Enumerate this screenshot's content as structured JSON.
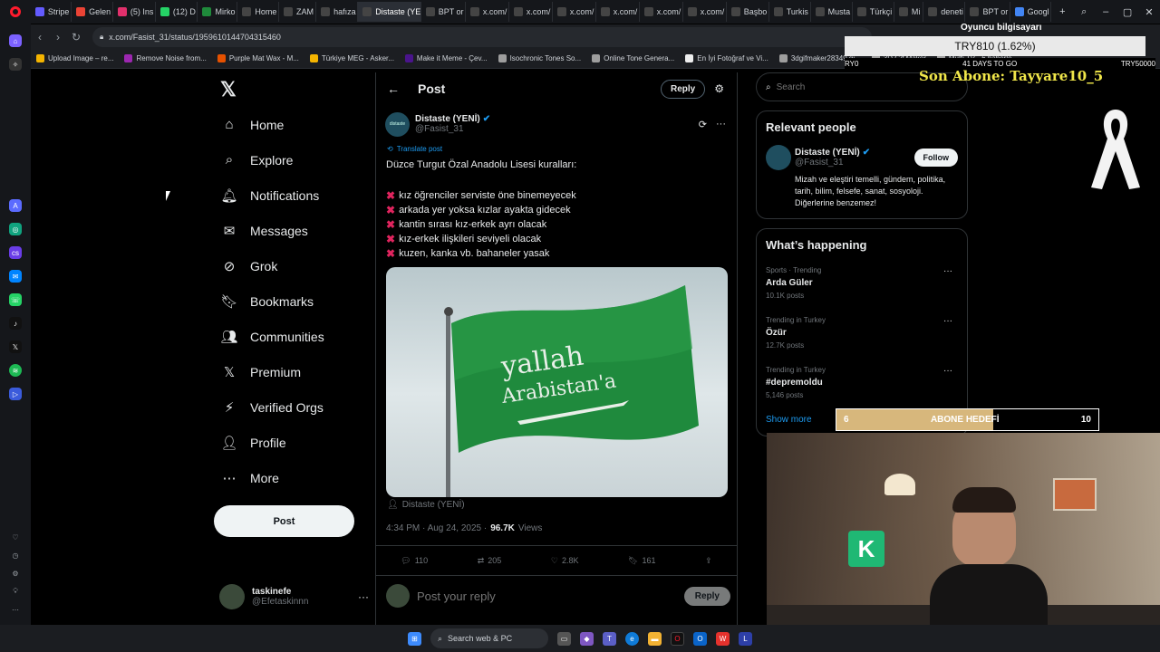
{
  "browser": {
    "tabs": [
      {
        "label": "Stripe",
        "color": "#635bff"
      },
      {
        "label": "Gelen",
        "color": "#ea4335"
      },
      {
        "label": "(5) Ins",
        "color": "#e1306c"
      },
      {
        "label": "(12) D",
        "color": "#25d366"
      },
      {
        "label": "Mirko",
        "color": "#1f8a3b"
      },
      {
        "label": "Home",
        "color": "#444"
      },
      {
        "label": "ZAM",
        "color": "#444"
      },
      {
        "label": "hafıza",
        "color": "#444"
      },
      {
        "label": "Distaste (YE",
        "color": "#444",
        "active": true
      },
      {
        "label": "BPT or",
        "color": "#444"
      },
      {
        "label": "x.com/",
        "color": "#444"
      },
      {
        "label": "x.com/",
        "color": "#444"
      },
      {
        "label": "x.com/",
        "color": "#444"
      },
      {
        "label": "x.com/",
        "color": "#444"
      },
      {
        "label": "x.com/",
        "color": "#444"
      },
      {
        "label": "x.com/",
        "color": "#444"
      },
      {
        "label": "Başbo",
        "color": "#444"
      },
      {
        "label": "Turkis",
        "color": "#444"
      },
      {
        "label": "Musta",
        "color": "#444"
      },
      {
        "label": "Türkçi",
        "color": "#444"
      },
      {
        "label": "Mi",
        "color": "#444"
      },
      {
        "label": "deneti",
        "color": "#444"
      },
      {
        "label": "BPT or",
        "color": "#444"
      },
      {
        "label": "Googl",
        "color": "#4285f4"
      }
    ],
    "url": "x.com/Fasist_31/status/1959610144704315460",
    "bookmarks": [
      {
        "label": "Upload Image – re...",
        "color": "#f4b400"
      },
      {
        "label": "Remove Noise from...",
        "color": "#9c27b0"
      },
      {
        "label": "Purple Mat Wax - M...",
        "color": "#e65100"
      },
      {
        "label": "Türkiye MEG - Asker...",
        "color": "#f4b400"
      },
      {
        "label": "Make it Meme - Çev...",
        "color": "#4a148c"
      },
      {
        "label": "Isochronic Tones So...",
        "color": "#9e9e9e"
      },
      {
        "label": "Online Tone Genera...",
        "color": "#9e9e9e"
      },
      {
        "label": "En İyi Fotoğraf ve Vi...",
        "color": "#eeeeee"
      },
      {
        "label": "3dgifmaker28349.gi...",
        "color": "#9e9e9e"
      },
      {
        "label": "3D Gif Maker",
        "color": "#9e9e9e"
      },
      {
        "label": "Multi TV - 6 haberle",
        "color": "#9e9e9e"
      }
    ]
  },
  "nav": {
    "items": [
      {
        "label": "Home",
        "icon": "home-icon"
      },
      {
        "label": "Explore",
        "icon": "search-icon"
      },
      {
        "label": "Notifications",
        "icon": "bell-icon"
      },
      {
        "label": "Messages",
        "icon": "mail-icon"
      },
      {
        "label": "Grok",
        "icon": "grok-icon"
      },
      {
        "label": "Bookmarks",
        "icon": "bookmark-icon"
      },
      {
        "label": "Communities",
        "icon": "people-icon"
      },
      {
        "label": "Premium",
        "icon": "x-icon"
      },
      {
        "label": "Verified Orgs",
        "icon": "bolt-icon"
      },
      {
        "label": "Profile",
        "icon": "user-icon"
      },
      {
        "label": "More",
        "icon": "more-icon"
      }
    ],
    "post_button": "Post",
    "account": {
      "name": "taskinefe",
      "handle": "@Efetaskinnn"
    }
  },
  "post": {
    "header_title": "Post",
    "reply_button": "Reply",
    "author_name": "Distaste (YENİ)",
    "author_handle": "@Fasist_31",
    "avatar_text": "distaste",
    "translate": "Translate post",
    "intro": "Düzce Turgut Özal Anadolu Lisesi kuralları:",
    "rules": [
      "kız öğrenciler serviste öne binemeyecek",
      "arkada yer yoksa kızlar ayakta gidecek",
      "kantin sırası kız-erkek ayrı olacak",
      "kız-erkek ilişkileri seviyeli olacak",
      "kuzen, kanka vb. bahaneler yasak"
    ],
    "flag_text_1": "yallah",
    "flag_text_2": "Arabistan'a",
    "image_credit": "Distaste (YENİ)",
    "timestamp": "4:34 PM · Aug 24, 2025 ·",
    "views_count": "96.7K",
    "views_label": "Views",
    "stats": {
      "replies": "110",
      "reposts": "205",
      "likes": "2.8K",
      "bookmarks": "161"
    },
    "reply_placeholder": "Post your reply",
    "reply_submit": "Reply"
  },
  "right": {
    "search_placeholder": "Search",
    "relevant_title": "Relevant people",
    "person": {
      "name": "Distaste (YENİ)",
      "handle": "@Fasist_31",
      "follow": "Follow",
      "bio": "Mizah ve eleştiri temelli, gündem, politika, tarih, bilim, felsefe, sanat, sosyoloji. Diğerlerine benzemez!"
    },
    "happening_title": "What’s happening",
    "trends": [
      {
        "context": "Sports · Trending",
        "name": "Arda Güler",
        "posts": "10.1K posts"
      },
      {
        "context": "Trending in Turkey",
        "name": "Özür",
        "posts": "12.7K posts"
      },
      {
        "context": "Trending in Turkey",
        "name": "#depremoldu",
        "posts": "5,146 posts"
      }
    ],
    "show_more": "Show more"
  },
  "overlay": {
    "player_label": "Oyuncu bilgisayarı",
    "price": "TRY810 (1.62%)",
    "left_code": "RY0",
    "days_to_go": "41 DAYS TO GO",
    "right_code": "TRY50000",
    "last_sub_label": "Son Abone: Tayyare10_5",
    "goal_current": "6",
    "goal_label": "ABONE HEDEFİ",
    "goal_target": "10",
    "goal_progress": 0.6
  },
  "taskbar": {
    "search_placeholder": "Search web & PC"
  }
}
